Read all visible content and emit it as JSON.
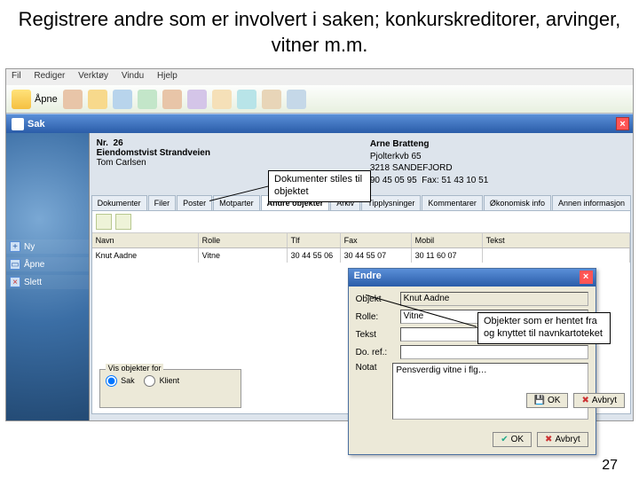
{
  "slide": {
    "title": "Registrere andre som er involvert i saken; konkurskreditorer, arvinger, vitner m.m.",
    "page_number": "27"
  },
  "callouts": {
    "c1": "Dokumenter stiles til objektet",
    "c2": "Objekter som er hentet fra og knyttet til navnkartoteket"
  },
  "app": {
    "menu": {
      "fil": "Fil",
      "rediger": "Rediger",
      "verktoy": "Verktøy",
      "vindu": "Vindu",
      "hjelp": "Hjelp"
    },
    "toolbar": {
      "apne": "Åpne"
    },
    "window_title": "Sak",
    "case": {
      "nr_label": "Nr.",
      "nr": "26",
      "title": "Eiendomstvist Strandveien",
      "owner": "Tom Carlsen",
      "party": {
        "name": "Arne Bratteng",
        "addr1": "Pjolterkvb 65",
        "addr2": "3218 SANDEFJORD",
        "phone1": "90 45 05 95",
        "phone2_label": "Fax:",
        "phone2": "51 43 10 51"
      }
    },
    "tabs": [
      "Dokumenter",
      "Filer",
      "Poster",
      "Motparter",
      "Andre objekter",
      "Arkiv",
      "Tipplysninger",
      "Kommentarer",
      "Økonomisk info",
      "Annen informasjon"
    ],
    "active_tab_index": 4,
    "grid": {
      "headers": {
        "navn": "Navn",
        "rolle": "Rolle",
        "tlf": "Tlf",
        "fax": "Fax",
        "mobil": "Mobil",
        "tekst": "Tekst"
      },
      "row": {
        "navn": "Knut Aadne",
        "rolle": "Vitne",
        "tlf": "30 44 55 06",
        "fax": "30 44 55 07",
        "mobil": "30 11 60 07",
        "tekst": ""
      }
    },
    "side_actions": {
      "ny": "Ny",
      "apne": "Åpne",
      "slett": "Slett"
    },
    "visbox": {
      "legend": "Vis objekter for",
      "sak": "Sak",
      "klient": "Klient"
    }
  },
  "dialog": {
    "title": "Endre",
    "labels": {
      "objekt": "Objekt",
      "rolle": "Rolle:",
      "tekst": "Tekst",
      "doref": "Do. ref.:",
      "notat": "Notat"
    },
    "values": {
      "objekt": "Knut Aadne",
      "rolle": "Vitne",
      "tekst": "",
      "doref": "",
      "notat": "Pensverdig vitne i flg…"
    },
    "buttons": {
      "ok": "OK",
      "avbryt": "Avbryt"
    }
  }
}
